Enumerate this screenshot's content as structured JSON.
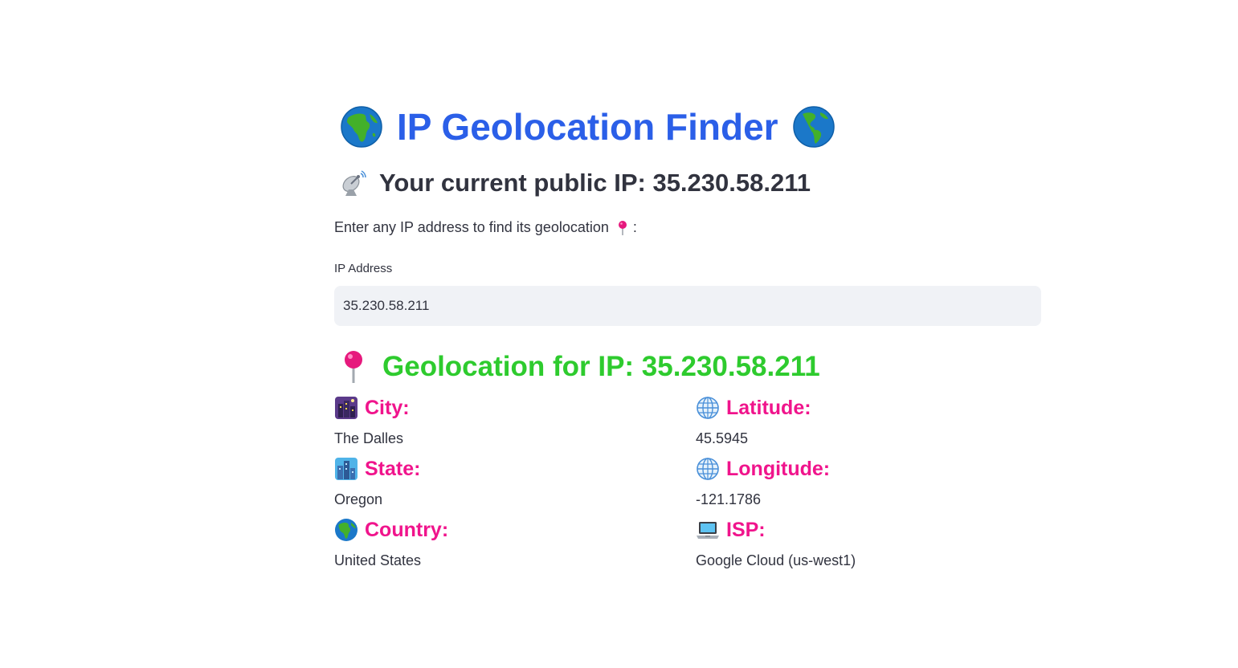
{
  "header": {
    "title": "IP Geolocation Finder",
    "left_icon": "globe-africa-icon",
    "right_icon": "globe-americas-icon",
    "title_color": "#2b5fe8"
  },
  "current_ip": {
    "text": "Your current public IP: 35.230.58.211",
    "icon": "satellite-antenna-icon"
  },
  "prompt": {
    "text": "Enter any IP address to find its geolocation",
    "suffix": ":",
    "icon": "round-pushpin-icon"
  },
  "ip_field": {
    "label": "IP Address",
    "value": "35.230.58.211",
    "background": "#f0f2f6"
  },
  "result": {
    "heading": "Geolocation for IP: 35.230.58.211",
    "heading_color": "#2ecb2e",
    "label_color": "#f0148c",
    "left_column": [
      {
        "label": "City:",
        "value": "The Dalles",
        "icon": "city-night-icon"
      },
      {
        "label": "State:",
        "value": "Oregon",
        "icon": "cityscape-icon"
      },
      {
        "label": "Country:",
        "value": "United States",
        "icon": "globe-icon"
      }
    ],
    "right_column": [
      {
        "label": "Latitude:",
        "value": "45.5945",
        "icon": "globe-meridians-icon"
      },
      {
        "label": "Longitude:",
        "value": "-121.1786",
        "icon": "globe-meridians-icon"
      },
      {
        "label": "ISP:",
        "value": "Google Cloud (us-west1)",
        "icon": "laptop-icon"
      }
    ]
  }
}
